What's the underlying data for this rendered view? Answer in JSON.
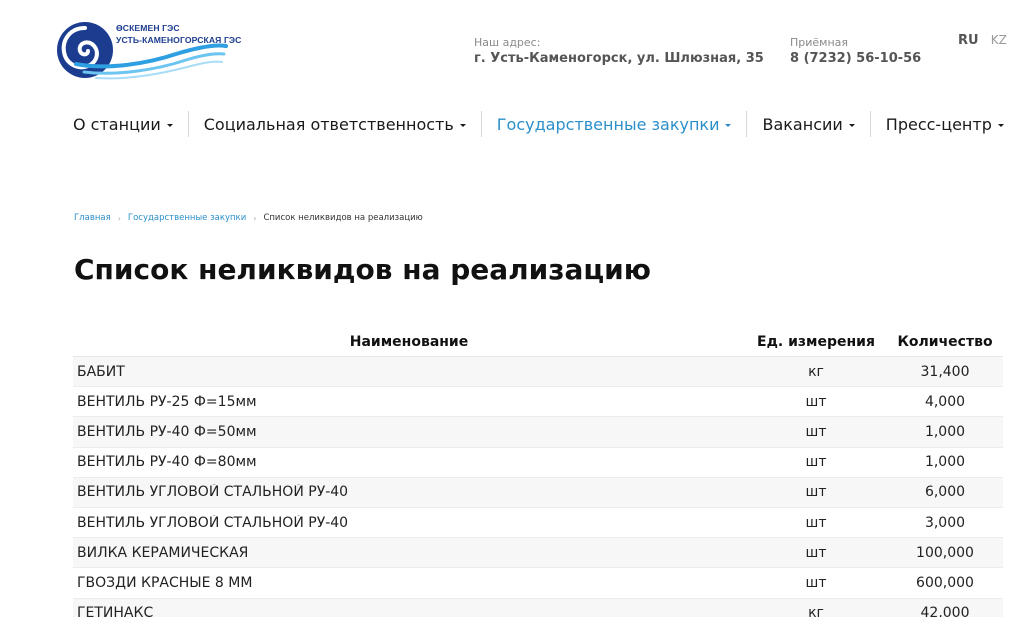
{
  "header": {
    "logo_line1": "ӨСКЕМЕН ГЭС",
    "logo_line2": "УСТЬ-КАМЕНОГОРСКАЯ ГЭС",
    "address_label": "Наш адрес:",
    "address_value": "г. Усть-Каменогорск, ул. Шлюзная, 35",
    "reception_label": "Приёмная",
    "reception_value": "8 (7232) 56-10-56",
    "lang_ru": "RU",
    "lang_kz": "KZ"
  },
  "nav": [
    {
      "label": "О станции"
    },
    {
      "label": "Социальная ответственность"
    },
    {
      "label": "Государственные закупки",
      "active": true
    },
    {
      "label": "Вакансии"
    },
    {
      "label": "Пресс-центр"
    }
  ],
  "breadcrumb": {
    "home": "Главная",
    "section": "Государственные закупки",
    "current": "Список неликвидов на реализацию"
  },
  "page_title": "Список неликвидов на реализацию",
  "table": {
    "headers": {
      "name": "Наименование",
      "unit": "Ед. измерения",
      "qty": "Количество"
    },
    "rows": [
      {
        "name": "БАБИТ",
        "unit": "кг",
        "qty": "31,400"
      },
      {
        "name": "ВЕНТИЛЬ РУ-25 Ф=15мм",
        "unit": "шт",
        "qty": "4,000"
      },
      {
        "name": "ВЕНТИЛЬ РУ-40 Ф=50мм",
        "unit": "шт",
        "qty": "1,000"
      },
      {
        "name": "ВЕНТИЛЬ РУ-40 Ф=80мм",
        "unit": "шт",
        "qty": "1,000"
      },
      {
        "name": "ВЕНТИЛЬ УГЛОВОЙ СТАЛЬНОЙ РУ-40",
        "unit": "шт",
        "qty": "6,000"
      },
      {
        "name": "ВЕНТИЛЬ УГЛОВОЙ СТАЛЬНОЙ РУ-40",
        "unit": "шт",
        "qty": "3,000"
      },
      {
        "name": "ВИЛКА КЕРАМИЧЕСКАЯ",
        "unit": "шт",
        "qty": "100,000"
      },
      {
        "name": "ГВОЗДИ КРАСНЫЕ 8 ММ",
        "unit": "шт",
        "qty": "600,000"
      },
      {
        "name": "ГЕТИНАКС",
        "unit": "кг",
        "qty": "42,000"
      }
    ]
  },
  "colors": {
    "accent": "#2b8fca",
    "logo_blue": "#1c3d8f"
  },
  "icons": {
    "logo": "wave-swirl-logo-icon",
    "nav_caret": "caret-down-icon",
    "breadcrumb_sep": "chevron-right-icon"
  }
}
